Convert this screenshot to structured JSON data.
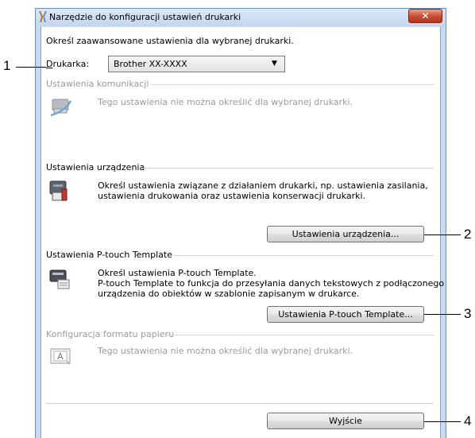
{
  "window": {
    "title": "Narzędzie do konfiguracji ustawień drukarki",
    "close_label": "✕"
  },
  "intro": "Określ zaawansowane ustawienia dla wybranej drukarki.",
  "printer": {
    "label": "Drukarka:",
    "selected": "Brother XX-XXXX"
  },
  "sections": {
    "communication": {
      "header": "Ustawienia komunikacji",
      "message": "Tego ustawienia nie można określić dla wybranej drukarki."
    },
    "device": {
      "header": "Ustawienia urządzenia",
      "line1": "Określ ustawienia związane z działaniem drukarki, np. ustawienia zasilania,",
      "line2": "ustawienia drukowania oraz ustawienia konserwacji drukarki.",
      "button": "Ustawienia urządzenia..."
    },
    "ptouch": {
      "header": "Ustawienia P-touch Template",
      "line1": "Określ ustawienia P-touch Template.",
      "line2": "P-touch Template to funkcja do przesyłania danych tekstowych z podłączonego",
      "line3": "urządzenia do obiektów w szablonie zapisanym w drukarce.",
      "button": "Ustawienia P-touch Template..."
    },
    "paper": {
      "header": "Konfiguracja formatu papieru",
      "message": "Tego ustawienia nie można określić dla wybranej drukarki."
    }
  },
  "exit_button": "Wyjście",
  "callouts": [
    "1",
    "2",
    "3",
    "4"
  ]
}
